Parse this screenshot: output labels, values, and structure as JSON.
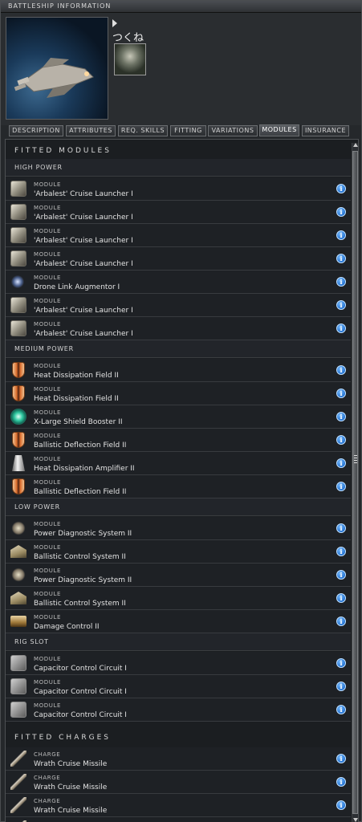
{
  "window": {
    "title": "BATTLESHIP INFORMATION"
  },
  "pilot": {
    "name": "つくね"
  },
  "tabs": [
    "DESCRIPTION",
    "ATTRIBUTES",
    "REQ. SKILLS",
    "FITTING",
    "VARIATIONS",
    "MODULES",
    "INSURANCE"
  ],
  "active_tab": "MODULES",
  "sections": {
    "fitted_modules": "FITTED MODULES",
    "fitted_charges": "FITTED CHARGES"
  },
  "groups": {
    "high": "HIGH POWER",
    "medium": "MEDIUM POWER",
    "low": "LOW POWER",
    "rig": "RIG SLOT"
  },
  "high_power": [
    {
      "kind": "MODULE",
      "name": "'Arbalest' Cruise Launcher I",
      "icon": "launcher-icon"
    },
    {
      "kind": "MODULE",
      "name": "'Arbalest' Cruise Launcher I",
      "icon": "launcher-icon"
    },
    {
      "kind": "MODULE",
      "name": "'Arbalest' Cruise Launcher I",
      "icon": "launcher-icon"
    },
    {
      "kind": "MODULE",
      "name": "'Arbalest' Cruise Launcher I",
      "icon": "launcher-icon"
    },
    {
      "kind": "MODULE",
      "name": "Drone Link Augmentor I",
      "icon": "drone-link-icon"
    },
    {
      "kind": "MODULE",
      "name": "'Arbalest' Cruise Launcher I",
      "icon": "launcher-icon"
    },
    {
      "kind": "MODULE",
      "name": "'Arbalest' Cruise Launcher I",
      "icon": "launcher-icon"
    }
  ],
  "medium_power": [
    {
      "kind": "MODULE",
      "name": "Heat Dissipation Field II",
      "icon": "shield-hardener-icon"
    },
    {
      "kind": "MODULE",
      "name": "Heat Dissipation Field II",
      "icon": "shield-hardener-icon"
    },
    {
      "kind": "MODULE",
      "name": "X-Large Shield Booster II",
      "icon": "shield-booster-icon"
    },
    {
      "kind": "MODULE",
      "name": "Ballistic Deflection Field II",
      "icon": "shield-hardener-icon"
    },
    {
      "kind": "MODULE",
      "name": "Heat Dissipation Amplifier II",
      "icon": "shield-amplifier-icon"
    },
    {
      "kind": "MODULE",
      "name": "Ballistic Deflection Field II",
      "icon": "shield-hardener-icon"
    }
  ],
  "low_power": [
    {
      "kind": "MODULE",
      "name": "Power Diagnostic System II",
      "icon": "power-diagnostic-icon"
    },
    {
      "kind": "MODULE",
      "name": "Ballistic Control System II",
      "icon": "ballistic-control-icon"
    },
    {
      "kind": "MODULE",
      "name": "Power Diagnostic System II",
      "icon": "power-diagnostic-icon"
    },
    {
      "kind": "MODULE",
      "name": "Ballistic Control System II",
      "icon": "ballistic-control-icon"
    },
    {
      "kind": "MODULE",
      "name": "Damage Control II",
      "icon": "damage-control-icon"
    }
  ],
  "rig_slot": [
    {
      "kind": "MODULE",
      "name": "Capacitor Control Circuit I",
      "icon": "rig-icon"
    },
    {
      "kind": "MODULE",
      "name": "Capacitor Control Circuit I",
      "icon": "rig-icon"
    },
    {
      "kind": "MODULE",
      "name": "Capacitor Control Circuit I",
      "icon": "rig-icon"
    }
  ],
  "charges": [
    {
      "kind": "CHARGE",
      "name": "Wrath Cruise Missile",
      "icon": "missile-icon"
    },
    {
      "kind": "CHARGE",
      "name": "Wrath Cruise Missile",
      "icon": "missile-icon"
    },
    {
      "kind": "CHARGE",
      "name": "Wrath Cruise Missile",
      "icon": "missile-icon"
    },
    {
      "kind": "CHARGE",
      "name": "",
      "icon": "missile-icon"
    }
  ]
}
